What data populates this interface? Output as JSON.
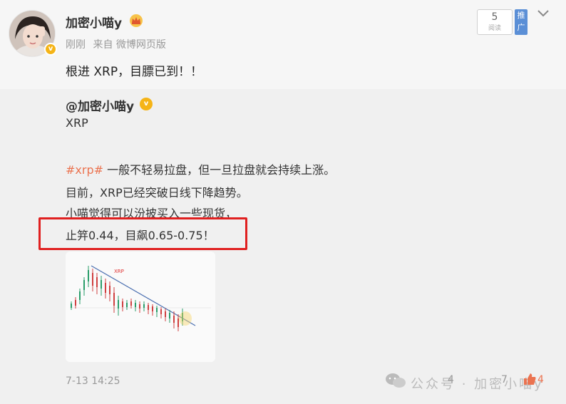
{
  "post": {
    "author": "加密小喵y",
    "meta": {
      "time": "刚刚",
      "source": "来自 微博网页版"
    },
    "read_count": "5",
    "read_label": "阅读",
    "push_label": "推广",
    "text": "根进 XRP，目膘已到！！"
  },
  "repost": {
    "author": "@加密小喵y",
    "lines": [
      "XRP",
      "",
      "一般不轻易拉盘，但一旦拉盘就会持续上涨。",
      "目前，XRP已经突破日线下降趋势。",
      "小喵觉得可以汾披买入一些现货，",
      "止笄0.44，目飙0.65-0.75！"
    ],
    "hashtag": "#xrp#",
    "chart_label": "XRP",
    "date": "7-13 14:25",
    "watermark": "公众号 · 加密小喵y",
    "counts": {
      "repost": "4",
      "comment": "7",
      "like": "4"
    }
  },
  "colors": {
    "hashtag": "#eb7350",
    "highlight": "#e02020",
    "vip": "#f5b417"
  }
}
